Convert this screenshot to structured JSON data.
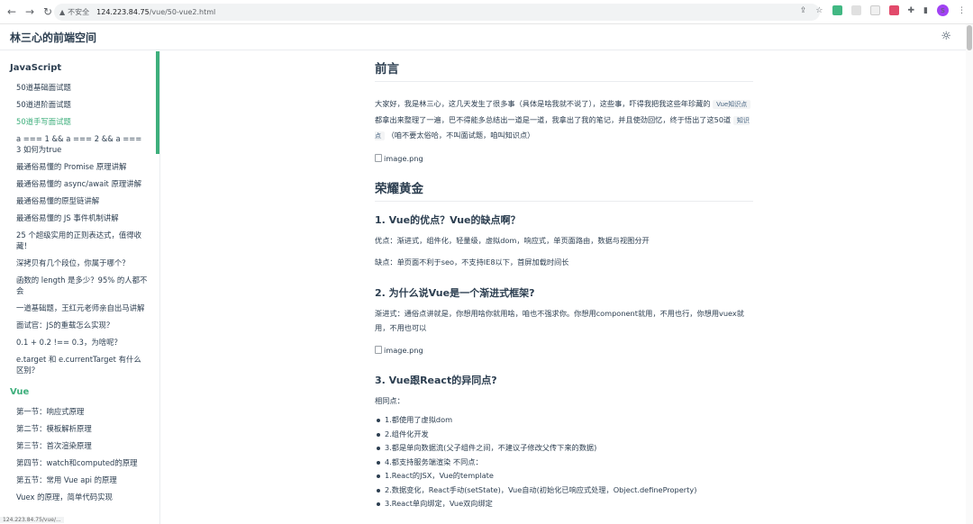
{
  "browser": {
    "insecure_label": "不安全",
    "url_host": "124.223.84.75",
    "url_path": "/vue/50-vue2.html",
    "profile_initial": "s"
  },
  "navbar": {
    "site_title": "林三心的前端空间"
  },
  "sidebar": {
    "groups": [
      {
        "title": "JavaScript",
        "items": [
          {
            "label": "50道基础面试题"
          },
          {
            "label": "50道进阶面试题"
          },
          {
            "label": "50道手写面试题"
          },
          {
            "label": "a === 1 && a === 2 && a === 3 如何为true"
          },
          {
            "label": "最通俗易懂的 Promise 原理讲解"
          },
          {
            "label": "最通俗易懂的 async/await 原理讲解"
          },
          {
            "label": "最通俗易懂的原型链讲解"
          },
          {
            "label": "最通俗易懂的 JS 事件机制讲解"
          },
          {
            "label": "25 个超级实用的正则表达式，值得收藏！"
          },
          {
            "label": "深拷贝有几个段位，你属于哪个？"
          },
          {
            "label": "函数的 length 是多少？95% 的人都不会"
          },
          {
            "label": "一道基础题，王红元老师亲自出马讲解"
          },
          {
            "label": "面试官：JS的重载怎么实现？"
          },
          {
            "label": "0.1 + 0.2 !== 0.3，为啥呢？"
          },
          {
            "label": "e.target 和 e.currentTarget 有什么区别？"
          }
        ]
      },
      {
        "title": "Vue",
        "items": [
          {
            "label": "第一节：响应式原理"
          },
          {
            "label": "第二节：模板解析原理"
          },
          {
            "label": "第三节：首次渲染原理"
          },
          {
            "label": "第四节：watch和computed的原理"
          },
          {
            "label": "第五节：常用 Vue api 的原理"
          },
          {
            "label": "Vuex 的原理，简单代码实现"
          }
        ]
      }
    ]
  },
  "content": {
    "preface_title": "前言",
    "preface": {
      "t1": "大家好，我是林三心，这几天发生了很多事（具体是啥我就不说了），这些事，吓得我把我这些年珍藏的",
      "code1": "Vue知识点",
      "t2": "都拿出来整理了一遍，巴不得能多总结出一道是一道，我拿出了我的笔记，并且使劲回忆，终于悟出了这50道",
      "code2": "知识点",
      "t3": "（咱不要太俗哈，不叫面试题，咱叫知识点）"
    },
    "image_alt": "image.png",
    "section_title": "荣耀黄金",
    "q1_title": "1. Vue的优点？Vue的缺点啊？",
    "q1_pro": "优点：渐进式，组件化，轻量级，虚拟dom，响应式，单页面路由，数据与视图分开",
    "q1_con": "缺点：单页面不利于seo，不支持IE8以下，首屏加载时间长",
    "q2_title": "2. 为什么说Vue是一个渐进式框架?",
    "q2_text": "渐进式：通俗点讲就是，你想用啥你就用啥，咱也不强求你。你想用component就用，不用也行，你想用vuex就用，不用也可以",
    "q3_title": "3. Vue跟React的异同点?",
    "q3_intro": "相同点：",
    "q3_list": [
      "1.都使用了虚拟dom",
      "2.组件化开发",
      "3.都是单向数据流(父子组件之间，不建议子修改父传下来的数据)",
      "4.都支持服务端渲染 不同点：",
      "1.React的JSX，Vue的template",
      "2.数据变化，React手动(setState)，Vue自动(初始化已响应式处理，Object.defineProperty)",
      "3.React单向绑定，Vue双向绑定"
    ]
  },
  "status_text": "124.223.84.75/vue/..."
}
